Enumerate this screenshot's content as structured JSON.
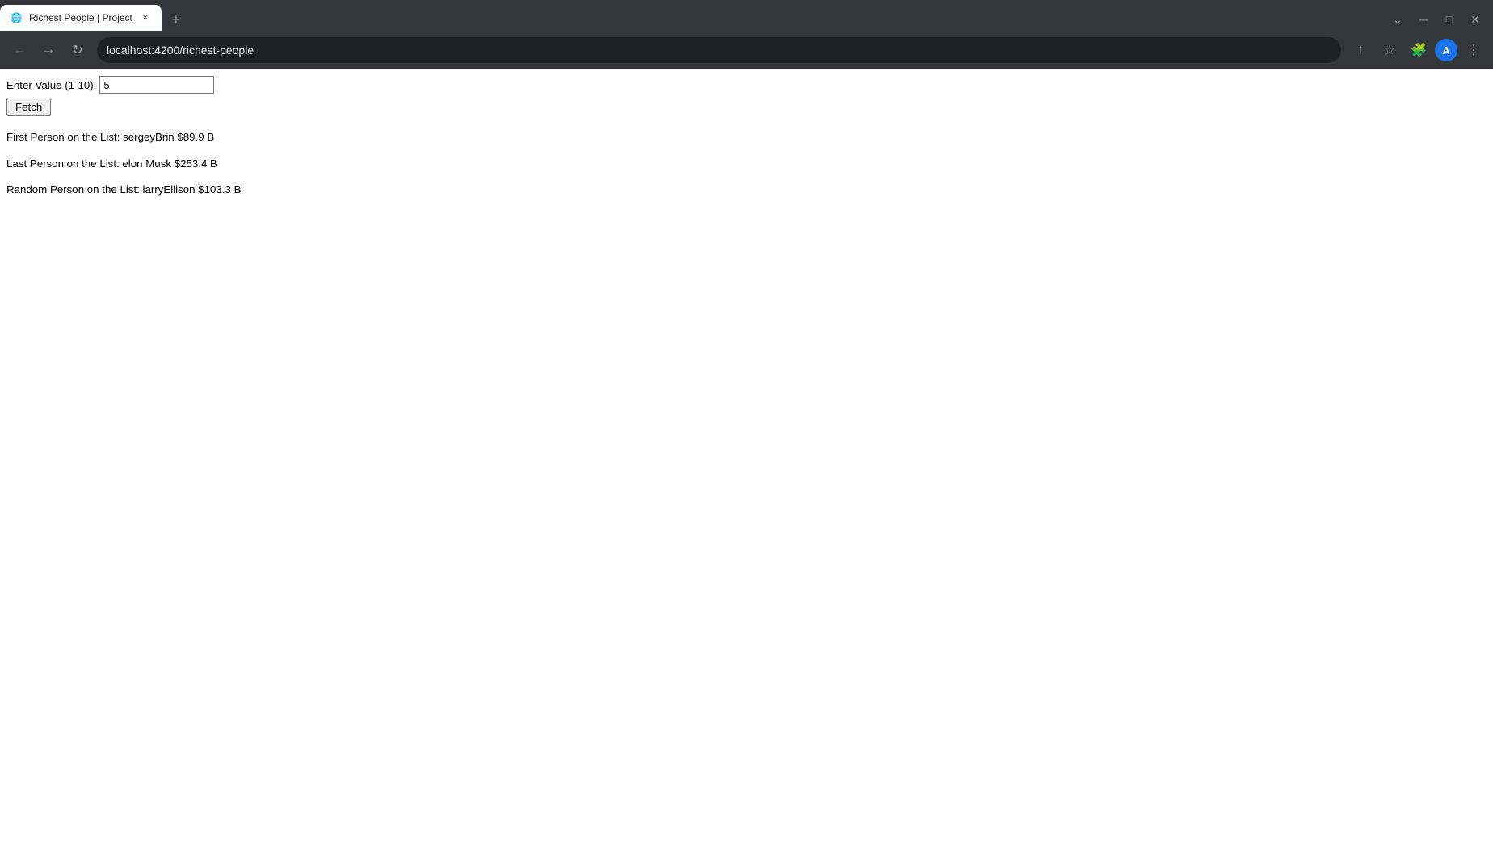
{
  "browser": {
    "tab": {
      "title": "Richest People | Project",
      "favicon": "🌐",
      "close_icon": "✕",
      "new_tab_icon": "+"
    },
    "tab_bar_right": {
      "dropdown_icon": "⌄",
      "minimize_icon": "─",
      "maximize_icon": "□",
      "close_icon": "✕"
    },
    "address_bar": {
      "back_icon": "←",
      "forward_icon": "→",
      "reload_icon": "↻",
      "url": "localhost:4200/richest-people",
      "bookmark_icon": "☆",
      "extensions_icon": "🧩",
      "profile_icon": "A",
      "menu_icon": "⋮",
      "share_icon": "↑"
    }
  },
  "page": {
    "form": {
      "label": "Enter Value (1-10):",
      "input_value": "5",
      "input_placeholder": "",
      "button_label": "Fetch"
    },
    "results": {
      "first_line": "First Person on the List: sergeyBrin $89.9 B",
      "last_line": "Last Person on the List: elon Musk $253.4 B",
      "random_line": "Random Person on the List: larryEllison $103.3 B"
    }
  }
}
